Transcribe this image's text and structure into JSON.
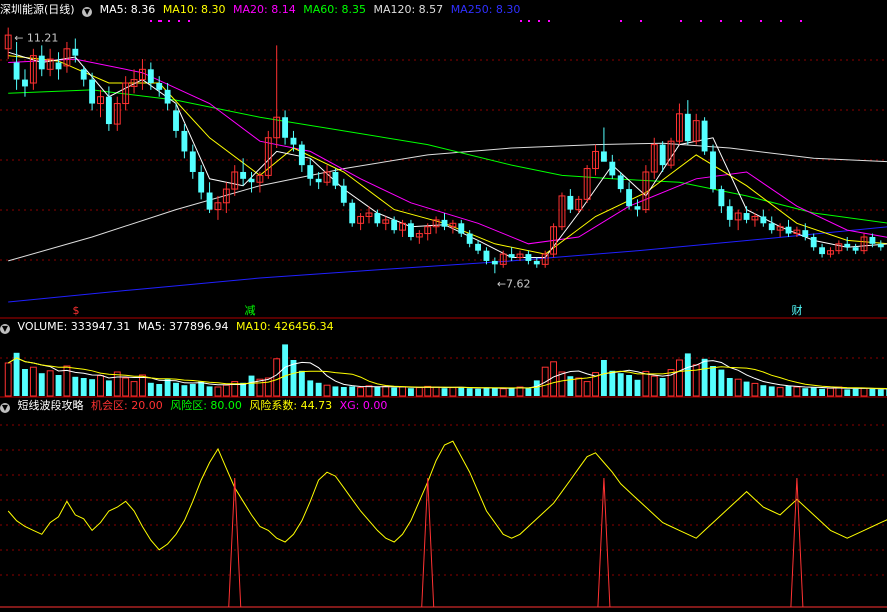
{
  "colors": {
    "bg": "#000000",
    "up": "#ff3232",
    "down": "#54ffff",
    "grid": "#8b0000",
    "ma5": "#ffffff",
    "ma10": "#ffff00",
    "ma20": "#ff00ff",
    "ma60": "#00ff00",
    "ma120": "#dedede",
    "ma250": "#2020ff"
  },
  "header_main": {
    "title": "深圳能源(日线)",
    "ma5": "MA5: 8.36",
    "ma10": "MA10: 8.30",
    "ma20": "MA20: 8.14",
    "ma60": "MA60: 8.35",
    "ma120": "MA120: 8.57",
    "ma250": "MA250: 8.30"
  },
  "header_volume": {
    "title": "VOLUME: 333947.31",
    "ma5": "MA5: 377896.94",
    "ma10": "MA10: 426456.34"
  },
  "header_indicator": {
    "title": "短线波段攻略",
    "chance": "机会区: 20.00",
    "risk": "风险区: 80.00",
    "coef": "风险系数: 44.73",
    "xg": "XG: 0.00"
  },
  "annotations": {
    "high_label": "11.21",
    "low_label": "7.62",
    "event1": "$",
    "event2": "减",
    "event3": "财"
  },
  "chart_data": {
    "type": "candlestick",
    "price_range": [
      7.2,
      11.35
    ],
    "high": 11.21,
    "low": 7.62,
    "candles": [
      [
        10.9,
        11.21,
        10.75,
        11.1
      ],
      [
        10.7,
        11.0,
        10.3,
        10.45
      ],
      [
        10.45,
        10.6,
        10.2,
        10.35
      ],
      [
        10.4,
        10.9,
        10.3,
        10.8
      ],
      [
        10.8,
        10.95,
        10.5,
        10.6
      ],
      [
        10.6,
        10.9,
        10.5,
        10.75
      ],
      [
        10.7,
        10.85,
        10.45,
        10.6
      ],
      [
        10.65,
        11.0,
        10.55,
        10.9
      ],
      [
        10.9,
        11.05,
        10.7,
        10.8
      ],
      [
        10.6,
        10.65,
        10.35,
        10.45
      ],
      [
        10.45,
        10.55,
        10.0,
        10.1
      ],
      [
        10.1,
        10.3,
        9.9,
        10.2
      ],
      [
        10.2,
        10.35,
        9.7,
        9.8
      ],
      [
        9.8,
        10.2,
        9.7,
        10.1
      ],
      [
        10.1,
        10.5,
        10.0,
        10.4
      ],
      [
        10.35,
        10.6,
        10.25,
        10.45
      ],
      [
        10.45,
        10.75,
        10.3,
        10.6
      ],
      [
        10.6,
        10.7,
        10.3,
        10.4
      ],
      [
        10.4,
        10.5,
        10.2,
        10.3
      ],
      [
        10.3,
        10.4,
        10.0,
        10.1
      ],
      [
        10.0,
        10.1,
        9.6,
        9.7
      ],
      [
        9.7,
        9.8,
        9.3,
        9.4
      ],
      [
        9.4,
        9.5,
        9.0,
        9.1
      ],
      [
        9.1,
        9.2,
        8.7,
        8.8
      ],
      [
        8.8,
        8.95,
        8.5,
        8.55
      ],
      [
        8.55,
        8.75,
        8.4,
        8.65
      ],
      [
        8.65,
        8.95,
        8.5,
        8.85
      ],
      [
        8.85,
        9.2,
        8.75,
        9.1
      ],
      [
        9.1,
        9.3,
        8.9,
        9.0
      ],
      [
        9.0,
        9.1,
        8.8,
        8.95
      ],
      [
        8.95,
        9.1,
        8.8,
        9.05
      ],
      [
        9.05,
        9.7,
        9.0,
        9.6
      ],
      [
        9.6,
        10.95,
        9.45,
        9.9
      ],
      [
        9.9,
        10.0,
        9.5,
        9.6
      ],
      [
        9.6,
        9.7,
        9.4,
        9.5
      ],
      [
        9.5,
        9.55,
        9.1,
        9.2
      ],
      [
        9.2,
        9.3,
        8.9,
        9.0
      ],
      [
        9.0,
        9.1,
        8.85,
        8.95
      ],
      [
        8.95,
        9.2,
        8.9,
        9.1
      ],
      [
        9.1,
        9.15,
        8.85,
        8.9
      ],
      [
        8.9,
        9.0,
        8.6,
        8.65
      ],
      [
        8.65,
        8.7,
        8.3,
        8.35
      ],
      [
        8.35,
        8.5,
        8.25,
        8.45
      ],
      [
        8.45,
        8.6,
        8.35,
        8.5
      ],
      [
        8.5,
        8.55,
        8.3,
        8.35
      ],
      [
        8.35,
        8.45,
        8.25,
        8.4
      ],
      [
        8.4,
        8.45,
        8.2,
        8.25
      ],
      [
        8.25,
        8.4,
        8.15,
        8.35
      ],
      [
        8.35,
        8.4,
        8.1,
        8.15
      ],
      [
        8.15,
        8.25,
        8.05,
        8.2
      ],
      [
        8.2,
        8.35,
        8.1,
        8.3
      ],
      [
        8.3,
        8.45,
        8.2,
        8.4
      ],
      [
        8.4,
        8.5,
        8.25,
        8.3
      ],
      [
        8.3,
        8.4,
        8.2,
        8.35
      ],
      [
        8.35,
        8.4,
        8.15,
        8.2
      ],
      [
        8.2,
        8.25,
        8.0,
        8.05
      ],
      [
        8.05,
        8.1,
        7.9,
        7.95
      ],
      [
        7.95,
        8.0,
        7.75,
        7.8
      ],
      [
        7.8,
        7.85,
        7.62,
        7.75
      ],
      [
        7.75,
        7.95,
        7.7,
        7.9
      ],
      [
        7.9,
        8.0,
        7.8,
        7.85
      ],
      [
        7.85,
        7.95,
        7.8,
        7.9
      ],
      [
        7.9,
        7.95,
        7.75,
        7.8
      ],
      [
        7.8,
        7.85,
        7.7,
        7.75
      ],
      [
        7.75,
        7.95,
        7.7,
        7.9
      ],
      [
        7.9,
        8.35,
        7.85,
        8.3
      ],
      [
        8.3,
        8.8,
        8.25,
        8.75
      ],
      [
        8.75,
        8.85,
        8.5,
        8.55
      ],
      [
        8.55,
        8.75,
        8.5,
        8.7
      ],
      [
        8.7,
        9.2,
        8.65,
        9.15
      ],
      [
        9.15,
        9.5,
        9.05,
        9.4
      ],
      [
        9.4,
        9.75,
        9.3,
        9.25
      ],
      [
        9.25,
        9.35,
        9.0,
        9.05
      ],
      [
        9.05,
        9.1,
        8.8,
        8.85
      ],
      [
        8.85,
        8.95,
        8.55,
        8.6
      ],
      [
        8.6,
        8.7,
        8.45,
        8.55
      ],
      [
        8.55,
        9.2,
        8.5,
        9.1
      ],
      [
        9.1,
        9.6,
        9.0,
        9.5
      ],
      [
        9.5,
        9.55,
        9.1,
        9.2
      ],
      [
        9.2,
        9.6,
        9.15,
        9.55
      ],
      [
        9.55,
        10.1,
        9.5,
        9.95
      ],
      [
        9.95,
        10.15,
        9.5,
        9.55
      ],
      [
        9.55,
        9.95,
        9.5,
        9.85
      ],
      [
        9.85,
        9.9,
        9.35,
        9.4
      ],
      [
        9.4,
        9.5,
        8.8,
        8.85
      ],
      [
        8.85,
        8.9,
        8.5,
        8.6
      ],
      [
        8.6,
        8.7,
        8.3,
        8.4
      ],
      [
        8.4,
        8.55,
        8.25,
        8.5
      ],
      [
        8.5,
        8.6,
        8.35,
        8.4
      ],
      [
        8.4,
        8.5,
        8.3,
        8.45
      ],
      [
        8.45,
        8.55,
        8.3,
        8.35
      ],
      [
        8.35,
        8.45,
        8.2,
        8.25
      ],
      [
        8.25,
        8.35,
        8.15,
        8.3
      ],
      [
        8.3,
        8.4,
        8.15,
        8.2
      ],
      [
        8.2,
        8.3,
        8.15,
        8.25
      ],
      [
        8.25,
        8.35,
        8.1,
        8.15
      ],
      [
        8.15,
        8.2,
        7.95,
        8.0
      ],
      [
        8.0,
        8.05,
        7.85,
        7.9
      ],
      [
        7.9,
        8.0,
        7.85,
        7.95
      ],
      [
        7.95,
        8.1,
        7.9,
        8.05
      ],
      [
        8.05,
        8.15,
        7.95,
        8.0
      ],
      [
        8.0,
        8.05,
        7.9,
        7.95
      ],
      [
        7.95,
        8.2,
        7.9,
        8.15
      ],
      [
        8.15,
        8.2,
        8.0,
        8.05
      ],
      [
        8.05,
        8.1,
        7.95,
        8.0
      ]
    ],
    "ma_lines": {
      "ma5": [
        [
          0,
          10.85
        ],
        [
          4,
          10.7
        ],
        [
          8,
          10.78
        ],
        [
          12,
          10.2
        ],
        [
          16,
          10.45
        ],
        [
          20,
          10.1
        ],
        [
          24,
          9.0
        ],
        [
          28,
          8.9
        ],
        [
          32,
          9.4
        ],
        [
          36,
          9.3
        ],
        [
          40,
          8.85
        ],
        [
          44,
          8.5
        ],
        [
          48,
          8.3
        ],
        [
          52,
          8.33
        ],
        [
          56,
          8.1
        ],
        [
          60,
          7.85
        ],
        [
          64,
          7.85
        ],
        [
          68,
          8.5
        ],
        [
          72,
          9.2
        ],
        [
          76,
          8.75
        ],
        [
          80,
          9.5
        ],
        [
          84,
          9.6
        ],
        [
          88,
          8.55
        ],
        [
          92,
          8.3
        ],
        [
          96,
          8.1
        ],
        [
          100,
          8.0
        ],
        [
          105,
          8.05
        ]
      ],
      "ma10": [
        [
          0,
          10.8
        ],
        [
          6,
          10.72
        ],
        [
          12,
          10.4
        ],
        [
          18,
          10.4
        ],
        [
          24,
          9.6
        ],
        [
          30,
          9.05
        ],
        [
          34,
          9.45
        ],
        [
          40,
          9.1
        ],
        [
          46,
          8.55
        ],
        [
          52,
          8.35
        ],
        [
          58,
          8.05
        ],
        [
          64,
          7.9
        ],
        [
          70,
          8.45
        ],
        [
          76,
          8.8
        ],
        [
          82,
          9.35
        ],
        [
          88,
          8.9
        ],
        [
          94,
          8.35
        ],
        [
          100,
          8.1
        ],
        [
          105,
          8.05
        ]
      ],
      "ma20": [
        [
          0,
          10.7
        ],
        [
          8,
          10.75
        ],
        [
          16,
          10.55
        ],
        [
          24,
          10.1
        ],
        [
          30,
          9.55
        ],
        [
          36,
          9.4
        ],
        [
          42,
          9.0
        ],
        [
          48,
          8.65
        ],
        [
          56,
          8.35
        ],
        [
          62,
          8.05
        ],
        [
          68,
          8.15
        ],
        [
          74,
          8.6
        ],
        [
          82,
          9.0
        ],
        [
          88,
          9.1
        ],
        [
          94,
          8.6
        ],
        [
          100,
          8.25
        ],
        [
          105,
          8.14
        ]
      ],
      "ma60": [
        [
          0,
          10.25
        ],
        [
          10,
          10.3
        ],
        [
          20,
          10.15
        ],
        [
          30,
          9.9
        ],
        [
          40,
          9.7
        ],
        [
          50,
          9.5
        ],
        [
          60,
          9.2
        ],
        [
          66,
          9.05
        ],
        [
          72,
          9.0
        ],
        [
          80,
          8.95
        ],
        [
          88,
          8.75
        ],
        [
          96,
          8.5
        ],
        [
          105,
          8.35
        ]
      ],
      "ma120": [
        [
          0,
          7.8
        ],
        [
          10,
          8.15
        ],
        [
          20,
          8.55
        ],
        [
          30,
          8.9
        ],
        [
          40,
          9.15
        ],
        [
          50,
          9.35
        ],
        [
          60,
          9.45
        ],
        [
          70,
          9.5
        ],
        [
          78,
          9.52
        ],
        [
          86,
          9.45
        ],
        [
          96,
          9.3
        ],
        [
          105,
          9.25
        ]
      ],
      "ma250": [
        [
          0,
          7.2
        ],
        [
          15,
          7.38
        ],
        [
          30,
          7.55
        ],
        [
          45,
          7.68
        ],
        [
          60,
          7.8
        ],
        [
          75,
          7.95
        ],
        [
          90,
          8.12
        ],
        [
          105,
          8.3
        ]
      ]
    },
    "volume": [
      0.55,
      0.72,
      0.45,
      0.48,
      0.38,
      0.42,
      0.35,
      0.5,
      0.32,
      0.3,
      0.28,
      0.34,
      0.26,
      0.4,
      0.3,
      0.24,
      0.35,
      0.22,
      0.2,
      0.28,
      0.22,
      0.18,
      0.2,
      0.24,
      0.16,
      0.15,
      0.18,
      0.24,
      0.22,
      0.34,
      0.28,
      0.3,
      0.62,
      0.86,
      0.6,
      0.42,
      0.26,
      0.22,
      0.18,
      0.16,
      0.15,
      0.16,
      0.14,
      0.17,
      0.15,
      0.16,
      0.14,
      0.15,
      0.13,
      0.14,
      0.16,
      0.15,
      0.13,
      0.14,
      0.15,
      0.13,
      0.12,
      0.14,
      0.13,
      0.12,
      0.14,
      0.15,
      0.13,
      0.26,
      0.48,
      0.57,
      0.4,
      0.33,
      0.3,
      0.24,
      0.39,
      0.6,
      0.42,
      0.38,
      0.35,
      0.27,
      0.41,
      0.33,
      0.3,
      0.44,
      0.6,
      0.71,
      0.52,
      0.62,
      0.5,
      0.44,
      0.3,
      0.28,
      0.24,
      0.21,
      0.18,
      0.16,
      0.14,
      0.17,
      0.15,
      0.13,
      0.14,
      0.12,
      0.13,
      0.15,
      0.11,
      0.12,
      0.13,
      0.12,
      0.11,
      0.12
    ],
    "indicator": [
      50,
      45,
      42,
      40,
      38,
      44,
      47,
      55,
      48,
      46,
      40,
      44,
      50,
      52,
      55,
      50,
      42,
      35,
      30,
      33,
      38,
      45,
      55,
      66,
      75,
      82,
      72,
      62,
      55,
      48,
      42,
      40,
      36,
      34,
      38,
      45,
      55,
      66,
      70,
      68,
      62,
      56,
      50,
      45,
      40,
      36,
      34,
      38,
      45,
      55,
      65,
      76,
      84,
      86,
      78,
      70,
      60,
      50,
      44,
      38,
      36,
      38,
      42,
      46,
      50,
      54,
      60,
      66,
      72,
      78,
      80,
      75,
      70,
      64,
      60,
      56,
      52,
      48,
      44,
      42,
      40,
      38,
      36,
      40,
      44,
      48,
      52,
      56,
      60,
      56,
      52,
      50,
      48,
      52,
      56,
      52,
      48,
      44,
      40,
      38,
      36,
      38,
      40,
      42,
      44,
      46
    ],
    "signals": [
      27,
      50,
      71,
      94
    ]
  }
}
